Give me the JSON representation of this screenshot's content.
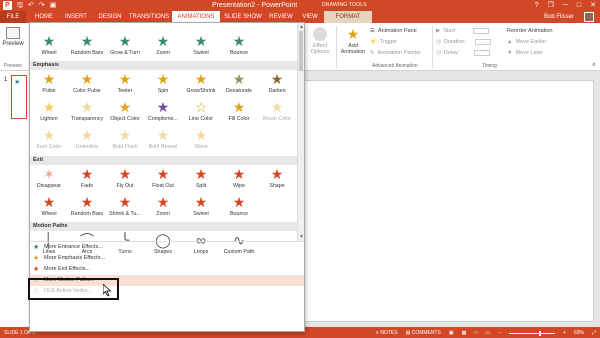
{
  "titlebar": {
    "app_icon": "P",
    "title": "Presentation2 - PowerPoint",
    "tools_label": "DRAWING TOOLS",
    "qat_icons": [
      "save-icon",
      "undo-icon",
      "redo-icon",
      "start-from-beginning-icon"
    ],
    "window_controls": [
      "?",
      "restore-icon",
      "─",
      "□",
      "✕"
    ]
  },
  "tabs": {
    "file": "FILE",
    "home": "HOME",
    "insert": "INSERT",
    "design": "DESIGN",
    "transitions": "TRANSITIONS",
    "animations": "ANIMATIONS",
    "slide_show": "SLIDE SHOW",
    "review": "REVIEW",
    "view": "VIEW",
    "format": "FORMAT",
    "user": "Bob Flisser"
  },
  "ribbon": {
    "preview_label": "Preview",
    "preview_group": "Preview",
    "effect_options": "Effect Options",
    "add_animation": "Add Animation",
    "animation_pane": "Animation Pane",
    "trigger": "Trigger",
    "animation_painter": "Animation Painter",
    "advanced_group": "Advanced Animation",
    "start": "Start:",
    "duration": "Duration:",
    "delay": "Delay:",
    "reorder": "Reorder Animation",
    "move_earlier": "Move Earlier",
    "move_later": "Move Later",
    "timing_group": "Timing"
  },
  "slides": {
    "number": "1"
  },
  "gallery": {
    "entrance_row": [
      "Wheel",
      "Random Bars",
      "Grow & Turn",
      "Zoom",
      "Swivel",
      "Bounce"
    ],
    "emphasis": {
      "header": "Emphasis",
      "row1": [
        "Pulse",
        "Color Pulse",
        "Teeter",
        "Spin",
        "Grow/Shrink",
        "Desaturate",
        "Darken"
      ],
      "row2": [
        "Lighten",
        "Transparency",
        "Object Color",
        "Compleme...",
        "Line Color",
        "Fill Color",
        "Brush Color"
      ],
      "row3": [
        "Font Color",
        "Underline",
        "Bold Flash",
        "Bold Reveal",
        "Wave"
      ]
    },
    "exit": {
      "header": "Exit",
      "row1": [
        "Disappear",
        "Fade",
        "Fly Out",
        "Float Out",
        "Split",
        "Wipe",
        "Shape"
      ],
      "row2": [
        "Wheel",
        "Random Bars",
        "Shrink & Tu...",
        "Zoom",
        "Swivel",
        "Bounce"
      ]
    },
    "motion": {
      "header": "Motion Paths",
      "row1": [
        "Lines",
        "Arcs",
        "Turns",
        "Shapes",
        "Loops",
        "Custom Path"
      ]
    },
    "more": {
      "entrance": "More Entrance Effects...",
      "emphasis": "More Emphasis Effects...",
      "exit": "More Exit Effects...",
      "motion": "More Motion Paths...",
      "ole": "OLE Action Verbs..."
    }
  },
  "statusbar": {
    "slide_of": "SLIDE 1 OF 1",
    "notes": "NOTES",
    "comments": "COMMENTS",
    "zoom": "69%"
  },
  "colors": {
    "brand": "#d24726",
    "entrance": "#3b8a6e",
    "emphasis": "#e0a41a",
    "exit": "#d24726",
    "highlight": "#fadfd4"
  }
}
